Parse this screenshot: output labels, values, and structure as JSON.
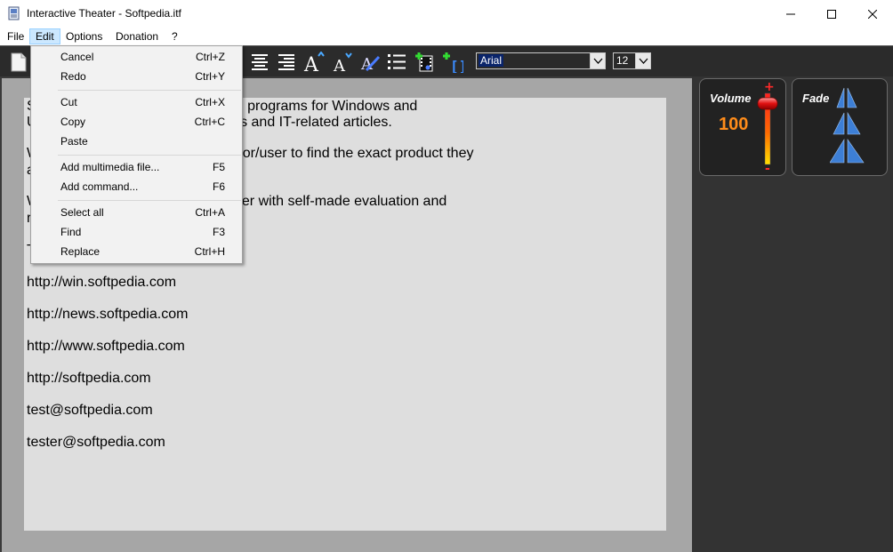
{
  "window": {
    "title": "Interactive Theater - Softpedia.itf"
  },
  "menubar": {
    "items": [
      "File",
      "Edit",
      "Options",
      "Donation",
      "?"
    ]
  },
  "toolbar": {
    "font_name": "Arial",
    "font_size": "12",
    "icons": [
      "new-document-icon",
      "align-center-icon",
      "align-right-icon",
      "font-grow-icon",
      "font-shrink-icon",
      "font-color-icon",
      "bullet-list-icon",
      "add-media-icon",
      "add-command-icon"
    ]
  },
  "edit_menu": {
    "items": [
      {
        "label": "Cancel",
        "shortcut": "Ctrl+Z"
      },
      {
        "label": "Redo",
        "shortcut": "Ctrl+Y"
      },
      {
        "label": "Cut",
        "shortcut": "Ctrl+X"
      },
      {
        "label": "Copy",
        "shortcut": "Ctrl+C"
      },
      {
        "label": "Paste",
        "shortcut": ""
      },
      {
        "label": "Add multimedia file...",
        "shortcut": "F5"
      },
      {
        "label": "Add command...",
        "shortcut": "F6"
      },
      {
        "label": "Select all",
        "shortcut": "Ctrl+A"
      },
      {
        "label": "Find",
        "shortcut": "F3"
      },
      {
        "label": "Replace",
        "shortcut": "Ctrl+H"
      }
    ]
  },
  "document": {
    "lines": [
      "S                                              000 free and free-to-try software programs for Windows and",
      "U                                              Windows drivers, mobile devices and IT-related articles.",
      "W                                              oducts in order to allow the visitor/user to find the exact product they",
      "a",
      "W                                              oducts to the visitor/user together with self-made evaluation and",
      "r",
      "T",
      "http://win.softpedia.com",
      "http://news.softpedia.com",
      "http://www.softpedia.com",
      "http://softpedia.com",
      "test@softpedia.com",
      "tester@softpedia.com"
    ]
  },
  "volume": {
    "title": "Volume",
    "value": "100",
    "plus": "+",
    "minus": "-"
  },
  "fade": {
    "title": "Fade"
  },
  "colors": {
    "accent_orange": "#ff8c1a",
    "menu_highlight": "#cce8ff",
    "toolbar_bg": "#2b2b2b",
    "panel_bg": "#333333"
  }
}
